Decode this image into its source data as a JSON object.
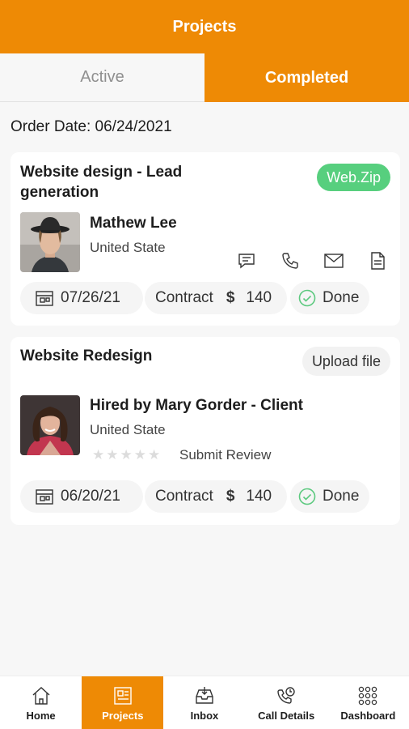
{
  "header": {
    "title": "Projects"
  },
  "tabs": {
    "active_label": "Active",
    "completed_label": "Completed"
  },
  "order_date": "Order Date: 06/24/2021",
  "projects": [
    {
      "title_line1": "Website design - Lead",
      "title_line2": "generation",
      "badge": "Web.Zip",
      "person": "Mathew Lee",
      "location": "United State",
      "date": "07/26/21",
      "contract_label": "Contract",
      "currency": "$",
      "amount": "140",
      "status": "Done"
    },
    {
      "title_line1": "Website Redesign",
      "badge": "Upload file",
      "person": "Hired by Mary Gorder - Client",
      "location": "United State",
      "review_label": "Submit Review",
      "rating": 0,
      "date": "06/20/21",
      "contract_label": "Contract",
      "currency": "$",
      "amount": "140",
      "status": "Done"
    }
  ],
  "nav": {
    "home": "Home",
    "projects": "Projects",
    "inbox": "Inbox",
    "call_details": "Call Details",
    "dashboard": "Dashboard"
  },
  "colors": {
    "accent": "#ee8a05",
    "badge_green": "#57cf7e",
    "done_green": "#5cc97f"
  }
}
